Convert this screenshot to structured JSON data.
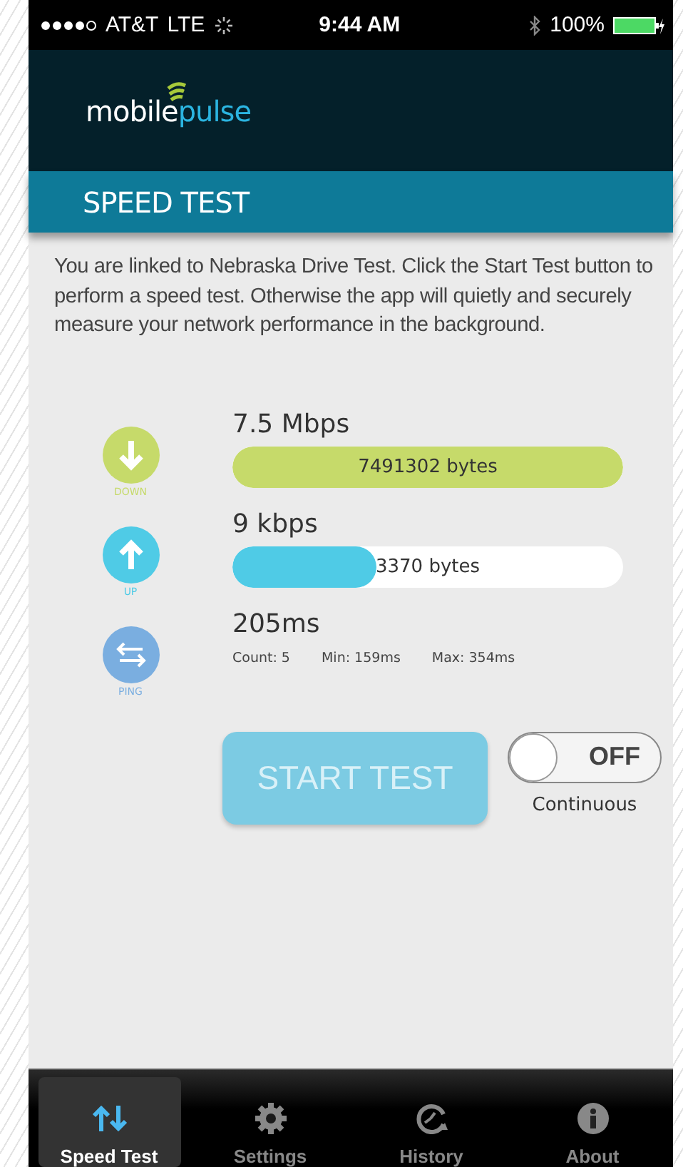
{
  "status_bar": {
    "carrier": "AT&T",
    "network": "LTE",
    "time": "9:44 AM",
    "battery": "100%"
  },
  "header": {
    "logo": [
      "mobile",
      "pulse"
    ]
  },
  "title": "SPEED TEST",
  "description": "You are linked to Nebraska Drive Test. Click the Start Test button to perform a speed test. Otherwise the app will quietly and securely measure your network performance in the background.",
  "metrics": [
    {
      "kind": "bar",
      "label": "DOWN",
      "value": "7.5 Mbps",
      "bar_text": "7491302 bytes",
      "level": 1.0
    },
    {
      "kind": "bar",
      "label": "UP",
      "value": "9 kbps",
      "bar_text": "3370 bytes",
      "level": 0.37
    },
    {
      "kind": "stats",
      "label": "PING",
      "value": "205ms",
      "stats": [
        "Count: 5",
        "Min: 159ms",
        "Max: 354ms"
      ]
    }
  ],
  "start_button": {
    "label": "START TEST",
    "disabled": true
  },
  "continuous": {
    "state_text": "OFF",
    "on": false,
    "label": "Continuous"
  },
  "tabs": [
    {
      "label": "Speed Test",
      "selected": true
    },
    {
      "label": "Settings",
      "selected": false
    },
    {
      "label": "History",
      "selected": false
    },
    {
      "label": "About",
      "selected": false
    }
  ]
}
